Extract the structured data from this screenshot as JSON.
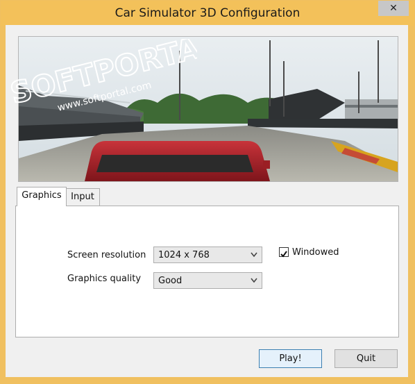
{
  "window": {
    "title": "Car Simulator 3D Configuration",
    "close_label": "✕"
  },
  "watermark": {
    "brand": "SOFTPORTAL",
    "url": "www.softportal.com"
  },
  "tabs": [
    {
      "label": "Graphics"
    },
    {
      "label": "Input"
    }
  ],
  "graphics": {
    "resolution_label": "Screen resolution",
    "resolution_value": "1024 x 768",
    "quality_label": "Graphics quality",
    "quality_value": "Good",
    "windowed_label": "Windowed",
    "windowed_checked": true
  },
  "buttons": {
    "play": "Play!",
    "quit": "Quit"
  },
  "colors": {
    "titlebar": "#f3c15a",
    "accent": "#3c7fb1"
  }
}
